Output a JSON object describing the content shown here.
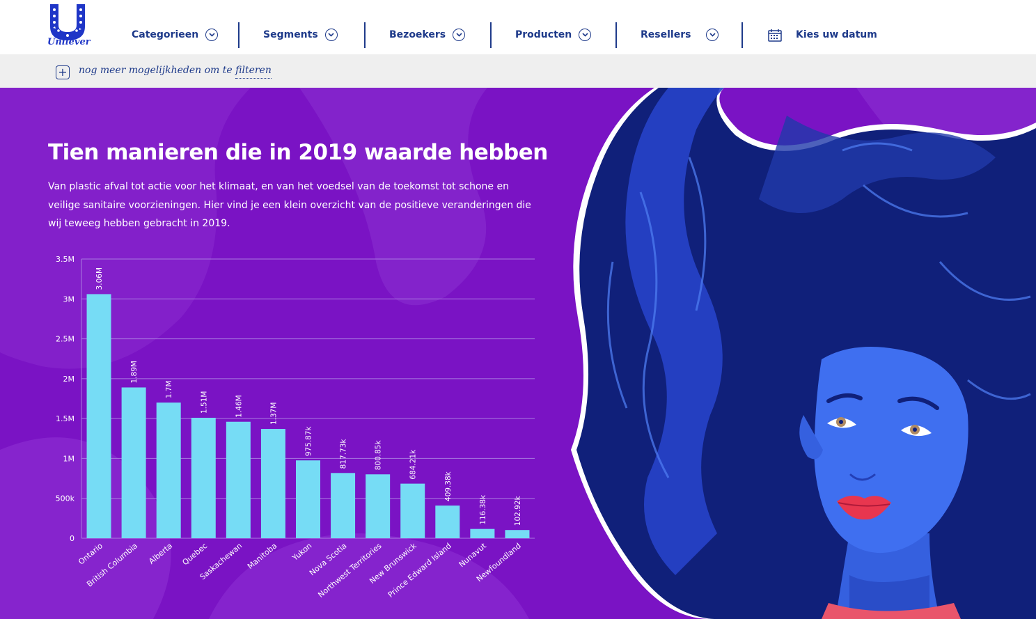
{
  "brand": {
    "name": "Unilever"
  },
  "nav": {
    "items": [
      {
        "label": "Categorieen"
      },
      {
        "label": "Segments"
      },
      {
        "label": "Bezoekers"
      },
      {
        "label": "Producten"
      },
      {
        "label": "Resellers"
      }
    ],
    "date_label": "Kies uw datum"
  },
  "filter": {
    "prefix": "nog meer mogelijkheden om te",
    "link": "filteren"
  },
  "hero": {
    "title": "Tien manieren die in 2019 waarde hebben",
    "description": "Van plastic afval tot actie voor het klimaat, en van het voedsel van de toekomst tot schone en veilige sanitaire voorzieningen. Hier vind je een klein overzicht van de positieve veranderingen die wij teweeg hebben gebracht in 2019."
  },
  "colors": {
    "nav_text": "#1e3a8a",
    "hero_bg": "#7a13c4",
    "bar": "#76dcf5",
    "hair": "#10207a",
    "skin": "#3f6ff0"
  },
  "chart_data": {
    "type": "bar",
    "categories": [
      "Ontario",
      "British Columbia",
      "Alberta",
      "Quebec",
      "Saskachewan",
      "Manitoba",
      "Yukon",
      "Nova Scotia",
      "Northwest Territories",
      "New Brunswick",
      "Prince Edward Island",
      "Nunavut",
      "Newfoundland"
    ],
    "values": [
      3060000,
      1890000,
      1700000,
      1510000,
      1460000,
      1370000,
      975870,
      817730,
      800850,
      684210,
      409380,
      116380,
      102920
    ],
    "data_labels": [
      "3.06M",
      "1.89M",
      "1.7M",
      "1.51M",
      "1.46M",
      "1.37M",
      "975.87k",
      "817.73k",
      "800.85k",
      "684.21k",
      "409.38k",
      "116.38k",
      "102.92k"
    ],
    "y_ticks": [
      0,
      500000,
      1000000,
      1500000,
      2000000,
      2500000,
      3000000,
      3500000
    ],
    "y_tick_labels": [
      "0",
      "500k",
      "1M",
      "1.5M",
      "2M",
      "2.5M",
      "3M",
      "3.5M"
    ],
    "ylim": [
      0,
      3500000
    ],
    "grid": true
  }
}
